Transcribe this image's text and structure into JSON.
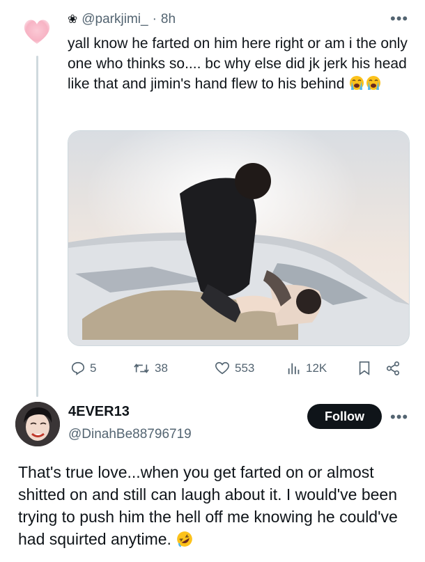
{
  "tweet1": {
    "handle": "@parkjimi_",
    "separator": "·",
    "time": "8h",
    "text": "yall know he farted on him here right or am i the only one who thinks so.... bc why else did jk jerk his head like that and jimin's hand flew to his behind",
    "emojis": [
      "loudly-crying-face",
      "loudly-crying-face"
    ],
    "more_label": "•••",
    "media_alt": "photo of two people on the hood of a white car",
    "stats": {
      "replies": "5",
      "reposts": "38",
      "likes": "553",
      "views": "12K"
    }
  },
  "tweet2": {
    "display_name": "4EVER13",
    "handle": "@DinahBe88796719",
    "follow_label": "Follow",
    "more_label": "•••",
    "text": "That's true love...when you get farted on or almost shitted on and still can laugh about it. I would've been trying to push him the hell off me knowing he could've had squirted anytime.",
    "emoji": "rolling-on-the-floor-laughing"
  },
  "colors": {
    "text_primary": "#0f1419",
    "text_secondary": "#536471",
    "border": "#cfd9de",
    "heart_pink": "#f8b8c8",
    "follow_bg": "#0f1419"
  }
}
